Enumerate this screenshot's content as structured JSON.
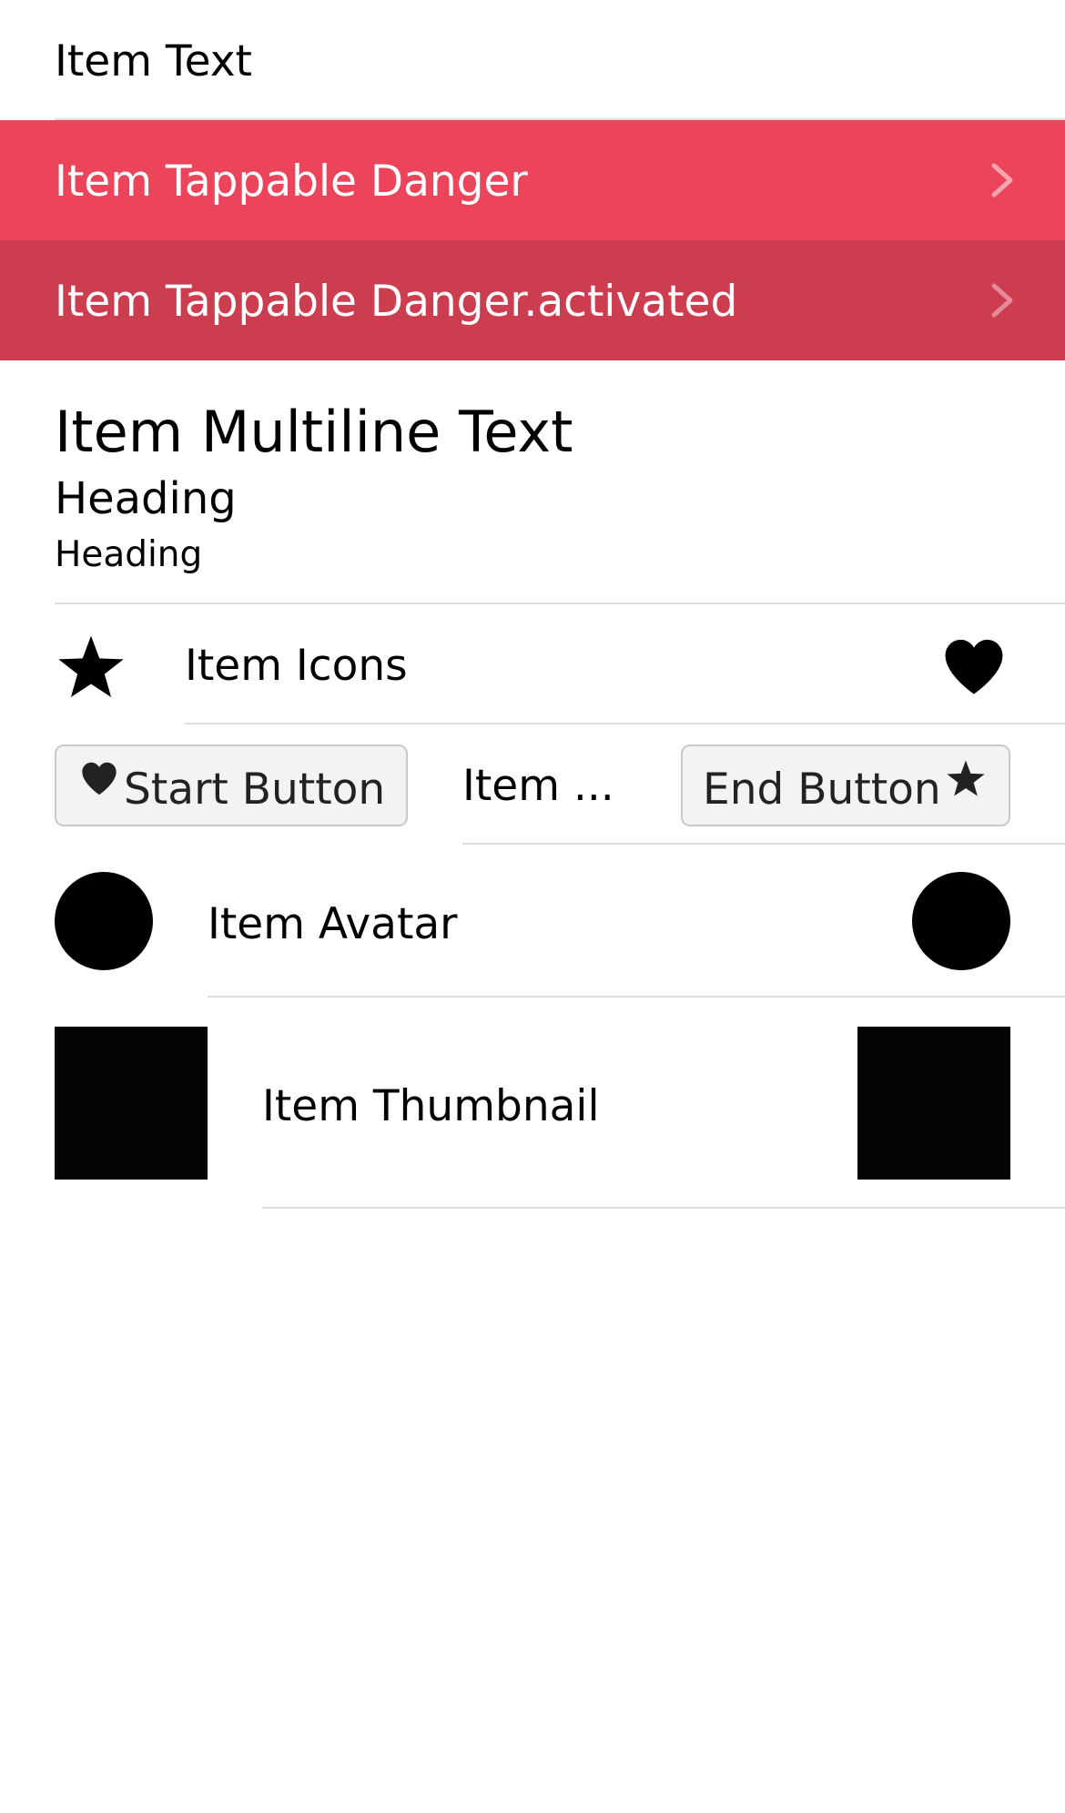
{
  "colors": {
    "danger": "#ec445a",
    "danger_activated": "#cc3d50",
    "divider": "#dddddd",
    "button_bg": "#f3f3f3"
  },
  "items": {
    "text": {
      "label": "Item Text"
    },
    "danger": {
      "label": "Item Tappable Danger",
      "icon": "chevron-right-icon"
    },
    "danger_activated": {
      "label": "Item Tappable Danger.activated",
      "icon": "chevron-right-icon"
    },
    "multiline": {
      "title": "Item Multiline Text",
      "heading1": "Heading",
      "heading2": "Heading"
    },
    "icons": {
      "label": "Item Icons",
      "start_icon": "star-icon",
      "end_icon": "heart-icon"
    },
    "buttons": {
      "start_label": "Start Button",
      "start_icon": "heart-icon",
      "middle_label": "Item ...",
      "end_label": "End Button",
      "end_icon": "star-icon"
    },
    "avatar": {
      "label": "Item Avatar"
    },
    "thumbnail": {
      "label": "Item Thumbnail"
    }
  }
}
